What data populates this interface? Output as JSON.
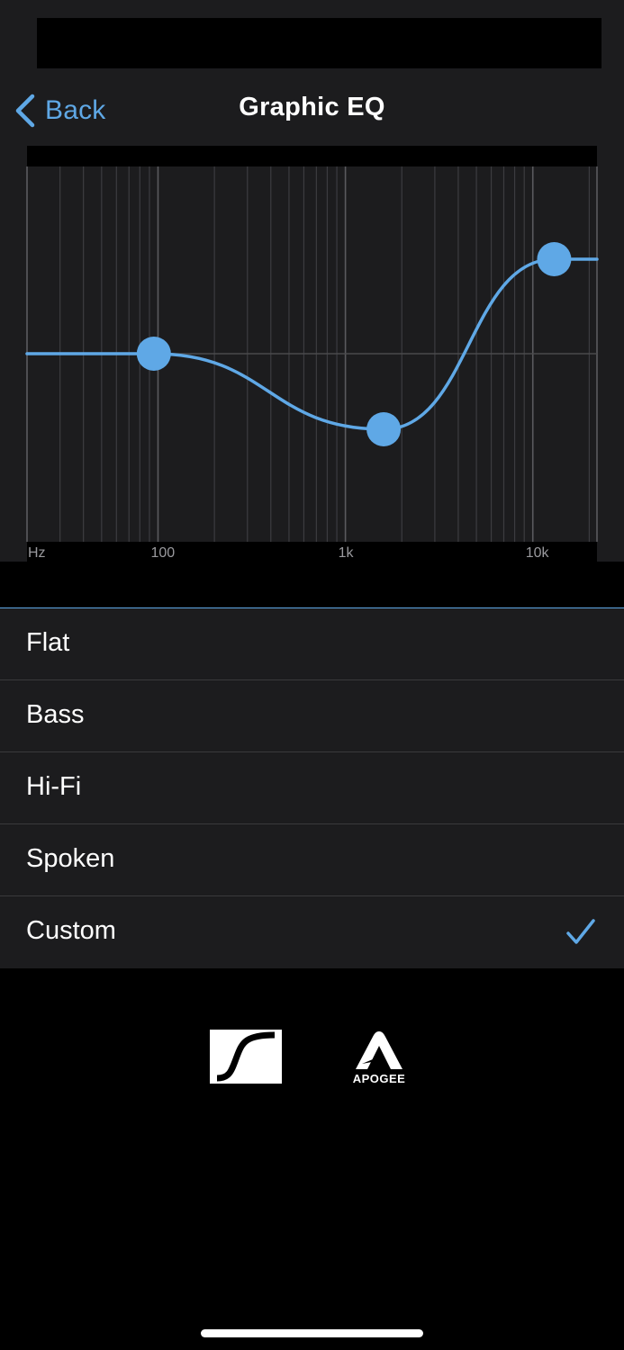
{
  "nav": {
    "back_label": "Back",
    "title": "Graphic EQ"
  },
  "eq": {
    "axis_labels": [
      "Hz",
      "100",
      "1k",
      "10k"
    ],
    "bands": [
      {
        "frequency_hz": 95,
        "gain_db": 0
      },
      {
        "frequency_hz": 1600,
        "gain_db": -4
      },
      {
        "frequency_hz": 13000,
        "gain_db": 5
      }
    ],
    "curve_color": "#5fa8e6"
  },
  "presets": [
    {
      "label": "Flat",
      "selected": false
    },
    {
      "label": "Bass",
      "selected": false
    },
    {
      "label": "Hi-Fi",
      "selected": false
    },
    {
      "label": "Spoken",
      "selected": false
    },
    {
      "label": "Custom",
      "selected": true
    }
  ],
  "brands": {
    "apogee_text": "APOGEE"
  },
  "colors": {
    "accent": "#5fa8e6",
    "panel": "#1c1c1e",
    "background": "#000000"
  }
}
